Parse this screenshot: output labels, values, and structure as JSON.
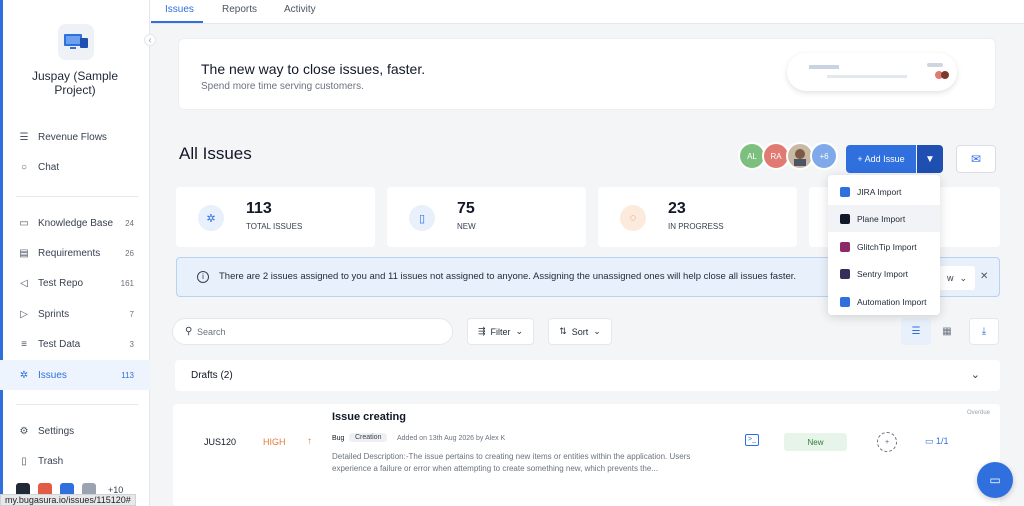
{
  "sidebar": {
    "project_name": "Juspay (Sample Project)",
    "items": [
      {
        "label": "Revenue Flows",
        "icon": "flow-icon",
        "count": ""
      },
      {
        "label": "Chat",
        "icon": "chat-icon",
        "count": ""
      },
      {
        "label": "Knowledge Base",
        "icon": "book-icon",
        "count": "24"
      },
      {
        "label": "Requirements",
        "icon": "requirements-icon",
        "count": "26"
      },
      {
        "label": "Test Repo",
        "icon": "send-icon",
        "count": "161"
      },
      {
        "label": "Sprints",
        "icon": "play-icon",
        "count": "7"
      },
      {
        "label": "Test Data",
        "icon": "database-icon",
        "count": "3"
      },
      {
        "label": "Issues",
        "icon": "bug-icon",
        "count": "113"
      },
      {
        "label": "Settings",
        "icon": "gear-icon",
        "count": ""
      },
      {
        "label": "Trash",
        "icon": "trash-icon",
        "count": ""
      }
    ],
    "active_item": "Issues",
    "integrations_more": "+10"
  },
  "status_url": "my.bugasura.io/issues/115120#",
  "tabs": [
    "Issues",
    "Reports",
    "Activity"
  ],
  "active_tab": "Issues",
  "banner": {
    "title": "The new way to close issues, faster.",
    "subtitle": "Spend more time serving customers."
  },
  "page": {
    "title": "All Issues",
    "add_issue_label": "+ Add Issue",
    "avatars": [
      {
        "initials": "AL",
        "color": "#7cbf7f"
      },
      {
        "initials": "RA",
        "color": "#e07a72"
      },
      {
        "initials": "",
        "color": "#c9b9a3"
      },
      {
        "initials": "+6",
        "color": "#7fa9e8"
      }
    ]
  },
  "stats": [
    {
      "value": "113",
      "label": "TOTAL ISSUES",
      "icon": "bug-icon"
    },
    {
      "value": "75",
      "label": "NEW",
      "icon": "file-icon"
    },
    {
      "value": "23",
      "label": "IN PROGRESS",
      "icon": "progress-icon"
    }
  ],
  "info": {
    "text": "There are 2 issues assigned to you and 11 issues not assigned to anyone. Assigning the unassigned ones will help close all issues faster.",
    "button_label": "w"
  },
  "toolbar": {
    "search_placeholder": "Search",
    "filter_label": "Filter",
    "sort_label": "Sort"
  },
  "drafts": {
    "label": "Drafts (2)"
  },
  "issue": {
    "id": "JUS120",
    "priority": "HIGH",
    "title": "Issue creating",
    "type": "Bug",
    "tag": "Creation",
    "meta": "Added on 13th Aug 2026 by Alex K",
    "description": "Detailed Description:-The issue pertains to creating new items or entities within the application. Users experience a failure or error when attempting to create something new, which prevents the...",
    "status": "New",
    "comments": "1/1",
    "due": "Overdue"
  },
  "import_menu": [
    {
      "label": "JIRA Import",
      "icon": "jira-icon",
      "color": "#2f6fde"
    },
    {
      "label": "Plane Import",
      "icon": "plane-icon",
      "color": "#111827"
    },
    {
      "label": "GlitchTip Import",
      "icon": "glitchtip-icon",
      "color": "#8b2a66"
    },
    {
      "label": "Sentry Import",
      "icon": "sentry-icon",
      "color": "#362d59"
    },
    {
      "label": "Automation Import",
      "icon": "automation-icon",
      "color": "#2f6fde"
    }
  ]
}
